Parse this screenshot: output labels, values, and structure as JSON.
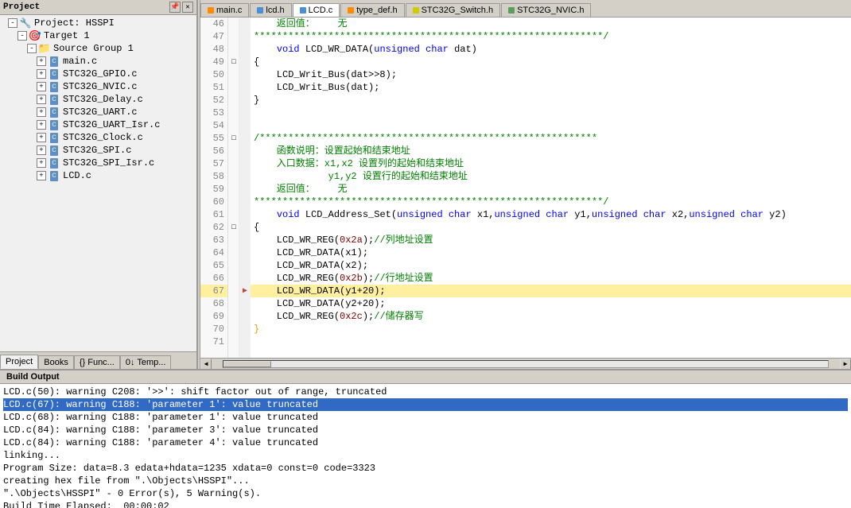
{
  "sidebar": {
    "title": "Project",
    "project_name": "Project: HSSPI",
    "target": "Target 1",
    "source_group": "Source Group 1",
    "files": [
      {
        "name": "main.c",
        "type": "c"
      },
      {
        "name": "STC32G_GPIO.c",
        "type": "c"
      },
      {
        "name": "STC32G_NVIC.c",
        "type": "c"
      },
      {
        "name": "STC32G_Delay.c",
        "type": "c"
      },
      {
        "name": "STC32G_UART.c",
        "type": "c"
      },
      {
        "name": "STC32G_UART_Isr.c",
        "type": "c"
      },
      {
        "name": "STC32G_Clock.c",
        "type": "c"
      },
      {
        "name": "STC32G_SPI.c",
        "type": "c"
      },
      {
        "name": "STC32G_SPI_Isr.c",
        "type": "c"
      },
      {
        "name": "LCD.c",
        "type": "c"
      }
    ],
    "tabs": [
      {
        "id": "project",
        "label": "Project"
      },
      {
        "id": "books",
        "label": "Books"
      },
      {
        "id": "funcs",
        "label": "{} Func..."
      },
      {
        "id": "temp",
        "label": "0↓ Temp..."
      }
    ]
  },
  "tabs": [
    {
      "id": "main_c",
      "label": "main.c",
      "color": "orange",
      "active": false
    },
    {
      "id": "lcd_h",
      "label": "lcd.h",
      "color": "blue",
      "active": false
    },
    {
      "id": "lcd_c",
      "label": "LCD.c",
      "color": "blue",
      "active": true
    },
    {
      "id": "type_def_h",
      "label": "type_def.h",
      "color": "orange",
      "active": false
    },
    {
      "id": "stc32g_switch_h",
      "label": "STC32G_Switch.h",
      "color": "yellow",
      "active": false
    },
    {
      "id": "stc32g_nvic_h",
      "label": "STC32G_NVIC.h",
      "color": "green",
      "active": false
    }
  ],
  "code": {
    "lines": [
      {
        "num": 46,
        "collapse": "",
        "arrow": false,
        "content": "    返回値：    无"
      },
      {
        "num": 47,
        "collapse": "",
        "arrow": false,
        "content": "*************************************************************/"
      },
      {
        "num": 48,
        "collapse": "",
        "arrow": false,
        "content": "    void LCD_WR_DATA(unsigned char dat)"
      },
      {
        "num": 49,
        "collapse": "-",
        "arrow": false,
        "content": "{"
      },
      {
        "num": 50,
        "collapse": "",
        "arrow": false,
        "content": "    LCD_Writ_Bus(dat>>8);"
      },
      {
        "num": 51,
        "collapse": "",
        "arrow": false,
        "content": "    LCD_Writ_Bus(dat);"
      },
      {
        "num": 52,
        "collapse": "",
        "arrow": false,
        "content": "}"
      },
      {
        "num": 53,
        "collapse": "",
        "arrow": false,
        "content": ""
      },
      {
        "num": 54,
        "collapse": "",
        "arrow": false,
        "content": ""
      },
      {
        "num": 55,
        "collapse": "-",
        "arrow": false,
        "content": "/***********************************************************"
      },
      {
        "num": 56,
        "collapse": "",
        "arrow": false,
        "content": "    函数说明： 设置起始和结束地址"
      },
      {
        "num": 57,
        "collapse": "",
        "arrow": false,
        "content": "    入口数据： x1,x2 设置列的起始和结束地址"
      },
      {
        "num": 58,
        "collapse": "",
        "arrow": false,
        "content": "             y1,y2 设置行的起始和结束地址"
      },
      {
        "num": 59,
        "collapse": "",
        "arrow": false,
        "content": "    返回値：    无"
      },
      {
        "num": 60,
        "collapse": "",
        "arrow": false,
        "content": "*************************************************************/"
      },
      {
        "num": 61,
        "collapse": "",
        "arrow": false,
        "content": "    void LCD_Address_Set(unsigned char x1,unsigned char y1,unsigned char x2,unsigned char y2)"
      },
      {
        "num": 62,
        "collapse": "-",
        "arrow": false,
        "content": "{"
      },
      {
        "num": 63,
        "collapse": "",
        "arrow": false,
        "content": "    LCD_WR_REG(0x2a);//列地址设置"
      },
      {
        "num": 64,
        "collapse": "",
        "arrow": false,
        "content": "    LCD_WR_DATA(x1);"
      },
      {
        "num": 65,
        "collapse": "",
        "arrow": false,
        "content": "    LCD_WR_DATA(x2);"
      },
      {
        "num": 66,
        "collapse": "",
        "arrow": false,
        "content": "    LCD_WR_REG(0x2b);//行地址设置"
      },
      {
        "num": 67,
        "collapse": "",
        "arrow": true,
        "content": "    LCD_WR_DATA(y1+20);"
      },
      {
        "num": 68,
        "collapse": "",
        "arrow": false,
        "content": "    LCD_WR_DATA(y2+20);"
      },
      {
        "num": 69,
        "collapse": "",
        "arrow": false,
        "content": "    LCD_WR_REG(0x2c);//储存器写"
      },
      {
        "num": 70,
        "collapse": "",
        "arrow": false,
        "content": "}"
      },
      {
        "num": 71,
        "collapse": "",
        "arrow": false,
        "content": ""
      }
    ]
  },
  "build_output": {
    "title": "Build Output",
    "lines": [
      {
        "text": "LCD.c(50): warning C208: '>>': shift factor out of range, truncated",
        "selected": false
      },
      {
        "text": "LCD.c(67): warning C188: 'parameter 1': value truncated",
        "selected": true
      },
      {
        "text": "LCD.c(68): warning C188: 'parameter 1': value truncated",
        "selected": false
      },
      {
        "text": "LCD.c(84): warning C188: 'parameter 3': value truncated",
        "selected": false
      },
      {
        "text": "LCD.c(84): warning C188: 'parameter 4': value truncated",
        "selected": false
      },
      {
        "text": "linking...",
        "selected": false
      },
      {
        "text": "Program Size: data=8.3 edata+hdata=1235 xdata=0 const=0 code=3323",
        "selected": false
      },
      {
        "text": "creating hex file from \".\\Objects\\HSSPI\"...",
        "selected": false
      },
      {
        "text": "\".\\Objects\\HSSPI\" - 0 Error(s), 5 Warning(s).",
        "selected": false
      },
      {
        "text": "Build Time Elapsed:  00:00:02",
        "selected": false
      }
    ]
  }
}
